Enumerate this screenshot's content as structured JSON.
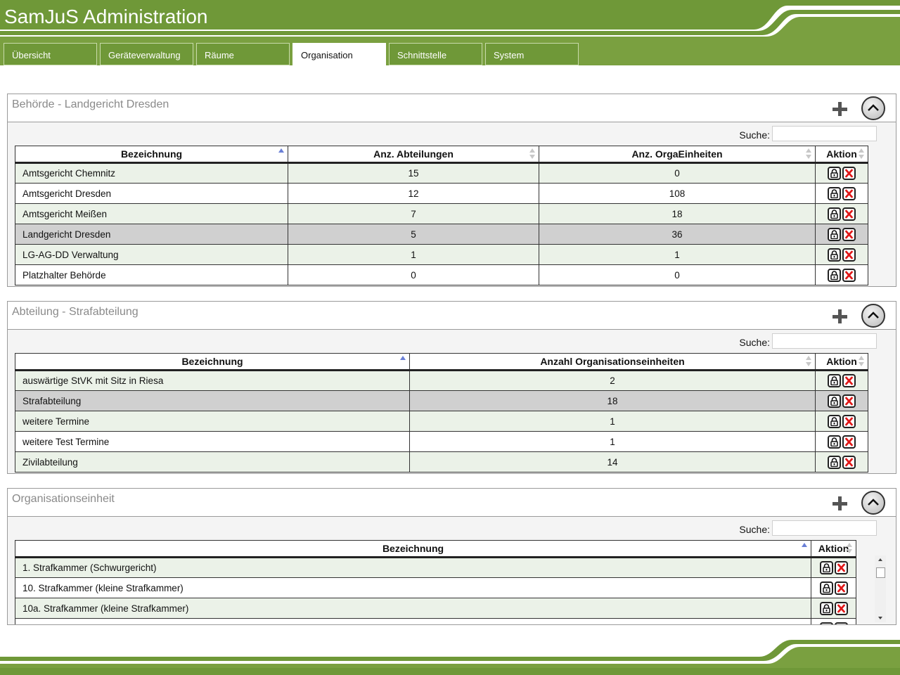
{
  "app": {
    "title": "SamJuS Administration"
  },
  "tabs": [
    {
      "label": "Übersicht"
    },
    {
      "label": "Geräteverwaltung"
    },
    {
      "label": "Räume"
    },
    {
      "label": "Organisation",
      "active": true
    },
    {
      "label": "Schnittstelle"
    },
    {
      "label": "System"
    }
  ],
  "colors": {
    "brand_green": "#6f9838",
    "row_alt": "#ebf2e8",
    "row_selected": "#d0d0d0",
    "delete_red": "#e01818"
  },
  "icons": {
    "add": "plus-icon",
    "collapse": "chevron-up-icon",
    "lock": "lock-icon",
    "delete": "delete-x-icon"
  },
  "behoerde": {
    "title": "Behörde - Landgericht Dresden",
    "search_label": "Suche:",
    "search_value": "",
    "columns": [
      "Bezeichnung",
      "Anz. Abteilungen",
      "Anz. OrgaEinheiten",
      "Aktion"
    ],
    "rows": [
      [
        "Amtsgericht Chemnitz",
        "15",
        "0"
      ],
      [
        "Amtsgericht Dresden",
        "12",
        "108"
      ],
      [
        "Amtsgericht Meißen",
        "7",
        "18"
      ],
      [
        "Landgericht Dresden",
        "5",
        "36"
      ],
      [
        "LG-AG-DD Verwaltung",
        "1",
        "1"
      ],
      [
        "Platzhalter Behörde",
        "0",
        "0"
      ]
    ],
    "selected_index": 3
  },
  "abteilung": {
    "title": "Abteilung - Strafabteilung",
    "search_label": "Suche:",
    "search_value": "",
    "columns": [
      "Bezeichnung",
      "Anzahl Organisationseinheiten",
      "Aktion"
    ],
    "rows": [
      [
        "auswärtige StVK mit Sitz in Riesa",
        "2"
      ],
      [
        "Strafabteilung",
        "18"
      ],
      [
        "weitere Termine",
        "1"
      ],
      [
        "weitere Test Termine",
        "1"
      ],
      [
        "Zivilabteilung",
        "14"
      ]
    ],
    "selected_index": 1
  },
  "orgaeinheit": {
    "title": "Organisationseinheit",
    "search_label": "Suche:",
    "search_value": "",
    "columns": [
      "Bezeichnung",
      "Aktion"
    ],
    "rows": [
      [
        "1. Strafkammer (Schwurgericht)"
      ],
      [
        "10. Strafkammer (kleine Strafkammer)"
      ],
      [
        "10a. Strafkammer (kleine Strafkammer)"
      ],
      [
        ""
      ]
    ],
    "selected_index": -1
  }
}
